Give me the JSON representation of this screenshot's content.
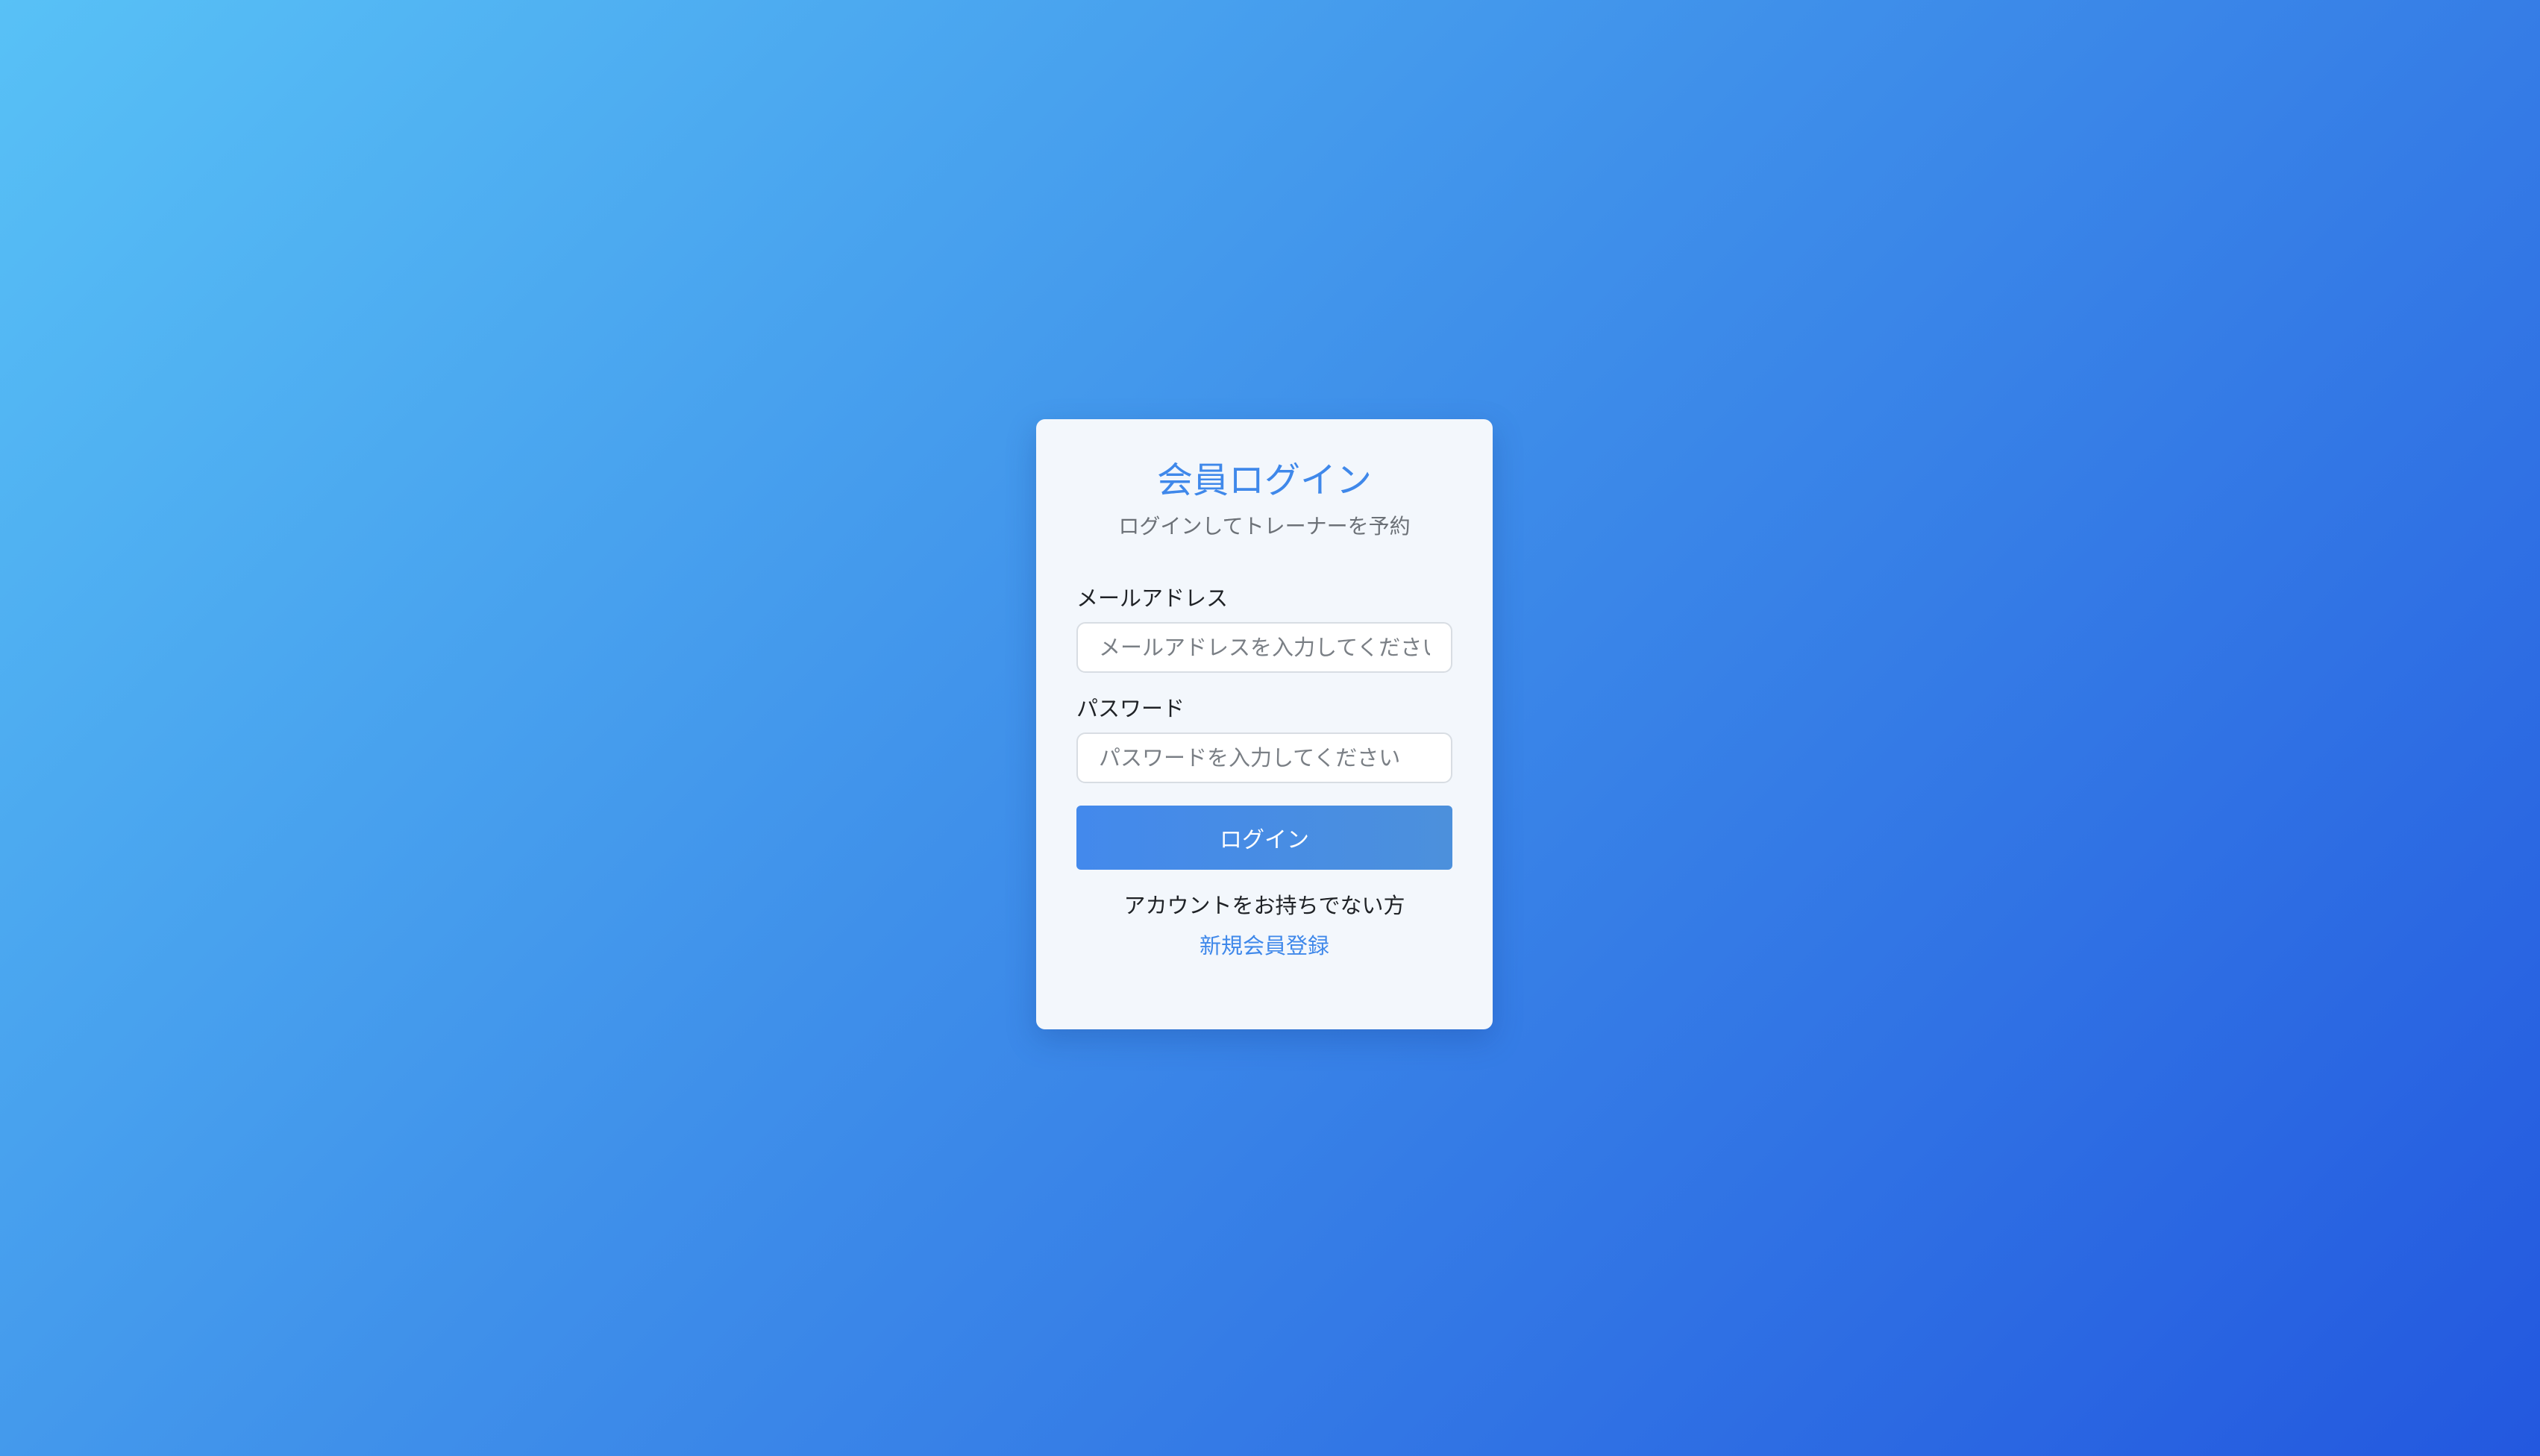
{
  "login_card": {
    "title": "会員ログイン",
    "subtitle": "ログインしてトレーナーを予約",
    "email": {
      "label": "メールアドレス",
      "placeholder": "メールアドレスを入力してください",
      "value": ""
    },
    "password": {
      "label": "パスワード",
      "placeholder": "パスワードを入力してください",
      "value": ""
    },
    "login_button_label": "ログイン",
    "no_account_text": "アカウントをお持ちでない方",
    "register_link_label": "新規会員登録"
  },
  "colors": {
    "accent": "#3f88ea",
    "background_start": "#58c1f6",
    "background_end": "#2358df",
    "card_background": "#f3f7fc"
  }
}
